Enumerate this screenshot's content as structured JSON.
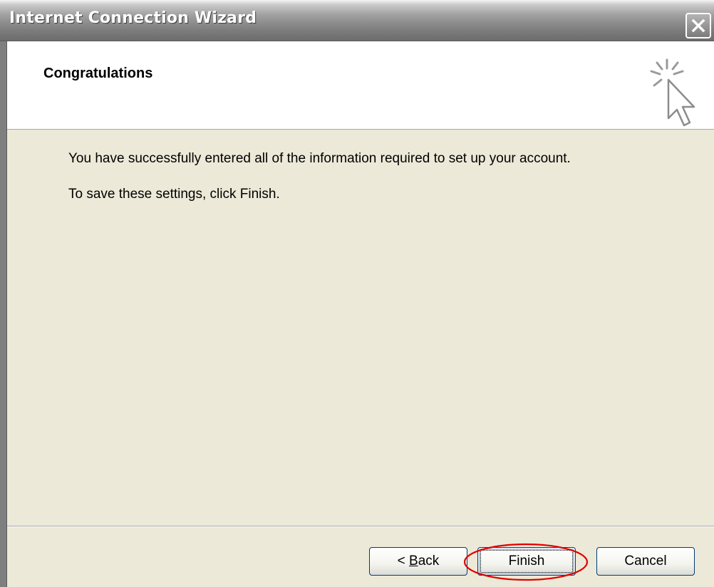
{
  "window": {
    "title": "Internet Connection Wizard"
  },
  "header": {
    "title": "Congratulations",
    "icon": "wizard-cursor-sparkle-icon"
  },
  "content": {
    "line1": "You have successfully entered all of the information required to set up your account.",
    "line2": "To save these settings, click Finish."
  },
  "buttons": {
    "back_prefix": "< ",
    "back_mnemonic": "B",
    "back_rest": "ack",
    "finish": "Finish",
    "cancel": "Cancel"
  },
  "annotation": {
    "highlight_color": "#E00000",
    "target": "finish-button"
  },
  "colors": {
    "dialog_bg": "#ECE9D8",
    "header_bg": "#FFFFFF",
    "title_gradient_top": "#F4F4F4",
    "title_gradient_bottom": "#6C6C6C",
    "button_border": "#003C74"
  }
}
